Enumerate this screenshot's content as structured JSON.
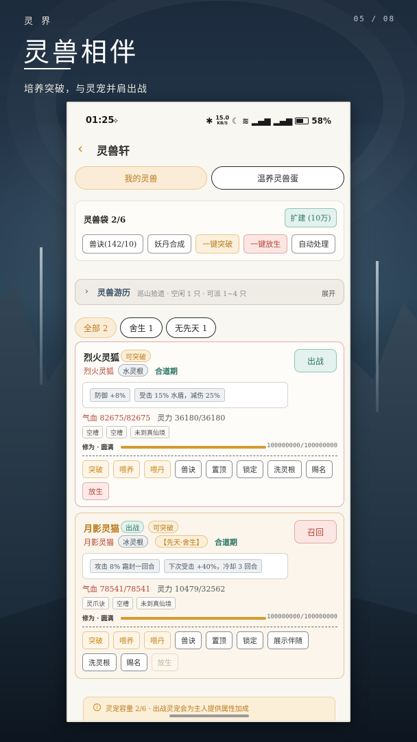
{
  "hero": {
    "tag": "灵 界",
    "page": "05 / 08",
    "title": "灵兽相伴",
    "subtitle": "培养突破，与灵宠并肩出战"
  },
  "status_bar": {
    "time": "01:25",
    "speed": "15.0",
    "speed_unit": "KB/S",
    "battery": "58%"
  },
  "nav": {
    "title": "灵兽轩"
  },
  "tabs": {
    "active": "我的灵兽",
    "other": "温养灵兽蛋"
  },
  "bag": {
    "title": "灵兽袋 2/6",
    "expand": "扩建 (10万)",
    "chips": [
      "兽诀(142/10)",
      "妖丹合成",
      "一键突破",
      "一键放生",
      "自动处理"
    ]
  },
  "journey": {
    "title": "灵兽游历",
    "desc": "巡山拾遗 · 空闲 1 只 · 可派 1~4 只",
    "expand": "展开"
  },
  "filters": [
    "全部 2",
    "舍生 1",
    "无先天 1"
  ],
  "pets": [
    {
      "name": "烈火灵狐",
      "badges": [
        "可突破"
      ],
      "species": "烈火灵狐",
      "root": "水灵根",
      "realm": "合道期",
      "action": "出战",
      "skills": [
        "防御 +8%",
        "受击 15% 水盾，减伤 25%"
      ],
      "hp": "气血 82675/82675",
      "sp": "灵力 36180/36180",
      "slots": [
        "空槽",
        "空槽",
        "未到真仙境"
      ],
      "cultivation_label": "修为 · 圆满",
      "cultivation_value": "100000000/100000000",
      "cultivation_fraction": 1.0,
      "actions": [
        "突破",
        "喂养",
        "喂丹",
        "兽诀",
        "置顶",
        "锁定",
        "洗灵根",
        "赐名",
        "放生"
      ]
    },
    {
      "name": "月影灵猫",
      "badges": [
        "出战",
        "可突破"
      ],
      "species": "月影灵猫",
      "root": "冰灵根",
      "innate": "【先天·舍生】",
      "realm": "合道期",
      "action": "召回",
      "skills": [
        "攻击 8% 霜封一回合",
        "下次受击 +40%，冷却 3 回合"
      ],
      "hp": "气血 78541/78541",
      "sp": "灵力 10479/32562",
      "slots": [
        "灵爪诀",
        "空槽",
        "未到真仙境"
      ],
      "cultivation_label": "修为 · 圆满",
      "cultivation_value": "100000000/100000000",
      "cultivation_fraction": 1.0,
      "actions": [
        "突破",
        "喂养",
        "喂丹",
        "兽诀",
        "置顶",
        "锁定",
        "展示伴随",
        "洗灵根",
        "赐名",
        "放生"
      ]
    }
  ],
  "notice": {
    "text": "灵宠容量 2/6 · 出战灵宠会为主人提供属性加成"
  }
}
